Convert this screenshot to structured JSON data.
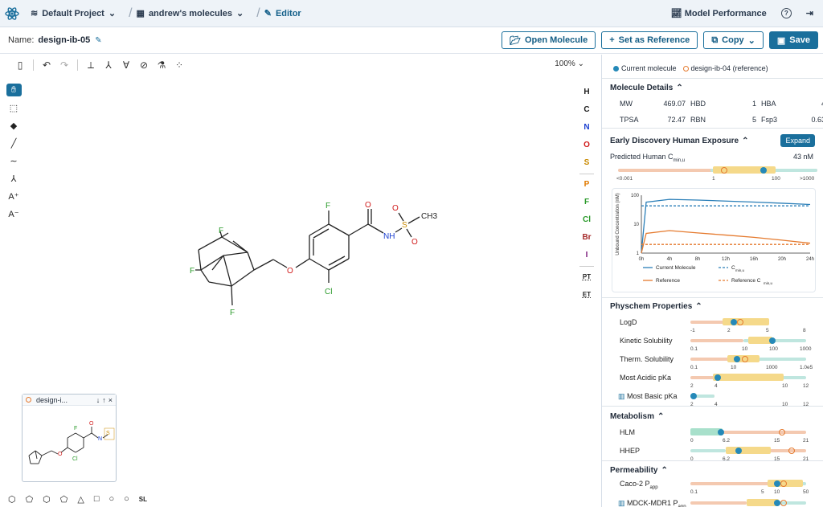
{
  "topbar": {
    "project": "Default Project",
    "molecule_set": "andrew's molecules",
    "editor": "Editor",
    "model_performance": "Model Performance",
    "help_icon": "question-circle-icon",
    "logout_icon": "logout-icon"
  },
  "namebar": {
    "label": "Name:",
    "value": "design-ib-05",
    "open_molecule": "Open Molecule",
    "set_reference": "Set as Reference",
    "copy": "Copy",
    "save": "Save"
  },
  "toolbar": {
    "zoom": "100%"
  },
  "atoms": [
    "H",
    "C",
    "N",
    "O",
    "S",
    "P",
    "F",
    "Cl",
    "Br",
    "I",
    "PT",
    "ET"
  ],
  "atom_colors": {
    "H": "#222",
    "C": "#222",
    "N": "#1a3fd0",
    "O": "#d01a1a",
    "S": "#c98a00",
    "P": "#e07a00",
    "F": "#2a9a2a",
    "Cl": "#2a9a2a",
    "Br": "#a52a2a",
    "I": "#7a1a7a",
    "PT": "#222",
    "ET": "#222"
  },
  "molecule_labels": {
    "f1": "F",
    "f2": "F",
    "f3": "F",
    "f4": "F",
    "o1": "O",
    "o2": "O",
    "n1": "NH",
    "s1": "S",
    "o3": "O",
    "o4": "O",
    "ch3": "CH3",
    "cl": "Cl"
  },
  "minimap": {
    "title": "design-i..."
  },
  "panel": {
    "legend_current": "Current molecule",
    "legend_reference": "design-ib-04 (reference)",
    "details_title": "Molecule Details",
    "details": [
      {
        "k": "MW",
        "v": "469.07"
      },
      {
        "k": "HBD",
        "v": "1"
      },
      {
        "k": "HBA",
        "v": "4"
      },
      {
        "k": "TPSA",
        "v": "72.47"
      },
      {
        "k": "RBN",
        "v": "5"
      },
      {
        "k": "Fsp3",
        "v": "0.63"
      }
    ],
    "exposure_title": "Early Discovery Human Exposure",
    "expand": "Expand",
    "predicted_label": "Predicted Human C",
    "predicted_sub": "min,u",
    "predicted_value": "43 nM",
    "exposure_ticks": [
      "<0.001",
      "1",
      "100",
      ">1000"
    ],
    "chart_legend": {
      "current": "Current Molecule",
      "cmin": "C",
      "cmin_sub": "min,u",
      "reference": "Reference",
      "ref_cmin": "Reference C",
      "ref_cmin_sub": "min,u"
    },
    "physchem_title": "Physchem Properties",
    "physchem": [
      {
        "name": "LogD",
        "ticks": [
          "-1",
          "2",
          "5",
          "8"
        ]
      },
      {
        "name": "Kinetic Solubility",
        "ticks": [
          "0.1",
          "10",
          "100",
          "1000"
        ]
      },
      {
        "name": "Therm. Solubility",
        "ticks": [
          "0.1",
          "10",
          "1000",
          "1.0e5"
        ]
      },
      {
        "name": "Most Acidic pKa",
        "ticks": [
          "2",
          "4",
          "10",
          "12"
        ]
      },
      {
        "name": "Most Basic pKa",
        "ticks": [
          "2",
          "4",
          "10",
          "12"
        ]
      }
    ],
    "metabolism_title": "Metabolism",
    "metabolism": [
      {
        "name": "HLM",
        "ticks": [
          "0",
          "6.2",
          "15",
          "21"
        ]
      },
      {
        "name": "HHEP",
        "ticks": [
          "0",
          "6.2",
          "15",
          "21"
        ]
      }
    ],
    "permeability_title": "Permeability",
    "permeability": [
      {
        "name": "Caco-2 P",
        "sub": "app",
        "ticks": [
          "0.1",
          "5",
          "10",
          "50"
        ]
      },
      {
        "name": "MDCK-MDR1 P",
        "sub": "app",
        "ticks": []
      }
    ]
  },
  "chart_data": {
    "type": "line",
    "ylabel": "Unbound Concentration (nM)",
    "x": [
      "0h",
      "4h",
      "8h",
      "12h",
      "16h",
      "20h",
      "24h"
    ],
    "yscale": "log",
    "yticks": [
      "1",
      "10",
      "100"
    ],
    "series": [
      {
        "name": "Current Molecule",
        "color": "#2b7fb8",
        "values": [
          1,
          72,
          68,
          63,
          58,
          53,
          48
        ]
      },
      {
        "name": "C",
        "color": "#2b7fb8",
        "dashed": true,
        "values": [
          43,
          43,
          43,
          43,
          43,
          43,
          43
        ]
      },
      {
        "name": "Reference",
        "color": "#e57a2e",
        "values": [
          1,
          6,
          5,
          4.2,
          3.5,
          2.8,
          2.2
        ]
      },
      {
        "name": "Reference C",
        "color": "#e57a2e",
        "dashed": true,
        "values": [
          2,
          2,
          2,
          2,
          2,
          2,
          2
        ]
      }
    ]
  }
}
